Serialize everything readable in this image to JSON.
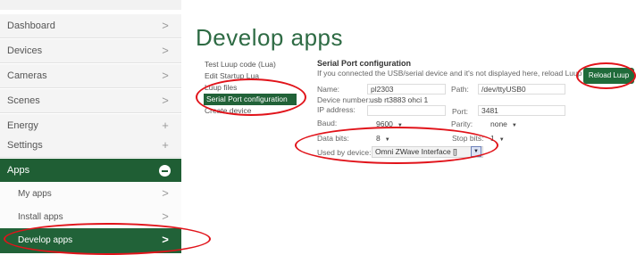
{
  "sidebar": {
    "items": [
      {
        "label": "Dashboard",
        "indicator": ">"
      },
      {
        "label": "Devices",
        "indicator": ">"
      },
      {
        "label": "Cameras",
        "indicator": ">"
      },
      {
        "label": "Scenes",
        "indicator": ">"
      },
      {
        "label": "Energy",
        "indicator": "+"
      },
      {
        "label": "Settings",
        "indicator": "+"
      },
      {
        "label": "Apps",
        "indicator": "minus"
      },
      {
        "label": "My apps",
        "indicator": ">"
      },
      {
        "label": "Install apps",
        "indicator": ">"
      },
      {
        "label": "Develop apps",
        "indicator": ">"
      }
    ]
  },
  "page": {
    "title": "Develop apps"
  },
  "submenu": [
    "Test Luup code (Lua)",
    "Edit Startup Lua",
    "Luup files",
    "Serial Port configuration",
    "Create device"
  ],
  "serial": {
    "title": "Serial Port configuration",
    "desc": "If you connected the USB/serial device and it's not displayed here, reload Luup",
    "reload_label": "Reload Luup",
    "name_label": "Name:",
    "name_value": "pl2303",
    "path_label": "Path:",
    "path_value": "/dev/ttyUSB0",
    "device_number_label": "Device number:",
    "device_number_value": "usb rt3883 ohci 1",
    "ip_label": "IP address:",
    "port_label": "Port:",
    "port_value": "3481",
    "baud_label": "Baud:",
    "baud_value": "9600",
    "parity_label": "Parity:",
    "parity_value": "none",
    "databits_label": "Data bits:",
    "databits_value": "8",
    "stopbits_label": "Stop bits:",
    "stopbits_value": "1",
    "usedby_label": "Used by device:",
    "usedby_value": "Omni ZWave Interface []"
  },
  "colors": {
    "accent": "#1f5e34",
    "title": "#2e6b44",
    "annotation": "#e1131a"
  }
}
